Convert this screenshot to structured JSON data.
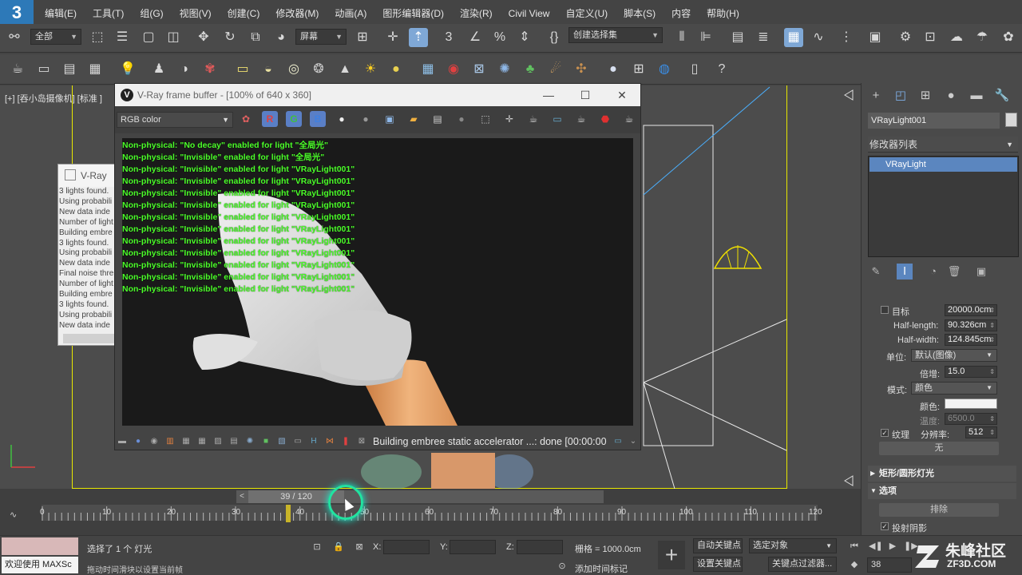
{
  "menu": {
    "logo": "3",
    "items": [
      "编辑(E)",
      "工具(T)",
      "组(G)",
      "视图(V)",
      "创建(C)",
      "修改器(M)",
      "动画(A)",
      "图形编辑器(D)",
      "渲染(R)",
      "Civil View",
      "自定义(U)",
      "脚本(S)",
      "内容",
      "帮助(H)"
    ]
  },
  "toolbar": {
    "filter_label": "全部",
    "ref_coord_label": "屏幕",
    "selection_set_label": "创建选择集"
  },
  "viewport": {
    "label": "[+] [吞小岛摄像机] [标准 ]"
  },
  "vray_log": {
    "title": "V-Ray",
    "lines": [
      "3 lights found.",
      "Using probabili",
      "New data inde",
      "Number of light",
      "Building embre",
      "3 lights found.",
      "Using probabili",
      "New data inde",
      "Final noise thre",
      "Number of light",
      "Building embre",
      "3 lights found.",
      "Using probabili",
      "New data inde"
    ]
  },
  "frame_buffer": {
    "title": "V-Ray frame buffer - [100% of 640 x 360]",
    "logo": "V",
    "channel": "RGB color",
    "minimize": "—",
    "maximize": "☐",
    "close": "✕",
    "render_log": [
      "Non-physical: \"No decay\" enabled for light \"全局光\"",
      "Non-physical: \"Invisible\" enabled for light \"全局光\"",
      "Non-physical: \"Invisible\" enabled for light \"VRayLight001\"",
      "Non-physical: \"Invisible\" enabled for light \"VRayLight001\"",
      "Non-physical: \"Invisible\" enabled for light \"VRayLight001\"",
      "Non-physical: \"Invisible\" enabled for light \"VRayLight001\"",
      "Non-physical: \"Invisible\" enabled for light \"VRayLight001\"",
      "Non-physical: \"Invisible\" enabled for light \"VRayLight001\"",
      "Non-physical: \"Invisible\" enabled for light \"VRayLight001\"",
      "Non-physical: \"Invisible\" enabled for light \"VRayLight001\"",
      "Non-physical: \"Invisible\" enabled for light \"VRayLight001\"",
      "Non-physical: \"Invisible\" enabled for light \"VRayLight001\"",
      "Non-physical: \"Invisible\" enabled for light \"VRayLight001\""
    ],
    "status": "Building embree static accelerator ...: done [00:00:00"
  },
  "command_panel": {
    "object_name": "VRayLight001",
    "modifier_list": "修改器列表",
    "stack_item": "VRayLight",
    "params": {
      "target_label": "目标",
      "target_value": "20000.0cm",
      "half_length_label": "Half-length:",
      "half_length_value": "90.326cm",
      "half_width_label": "Half-width:",
      "half_width_value": "124.845cm",
      "units_label": "单位:",
      "units_value": "默认(图像)",
      "multiplier_label": "倍增:",
      "multiplier_value": "15.0",
      "mode_label": "模式:",
      "mode_value": "颜色",
      "color_label": "颜色:",
      "temperature_label": "温度:",
      "temperature_value": "6500.0",
      "texture_label": "纹理",
      "resolution_label": "分辨率:",
      "resolution_value": "512",
      "none_button": "无"
    },
    "rollout_rect": "矩形/圆形灯光",
    "rollout_options": "选项",
    "exclude_button": "排除",
    "cast_shadows_label": "投射阴影"
  },
  "timeline": {
    "slider_text": "39 / 120",
    "ticks": [
      "0",
      "10",
      "20",
      "30",
      "40",
      "50",
      "60",
      "70",
      "80",
      "90",
      "100",
      "110",
      "120"
    ]
  },
  "status_bar": {
    "maxscript": "欢迎使用 MAXSc",
    "line1": "选择了 1 个 灯光",
    "line2": "拖动时间滑块以设置当前帧",
    "x_label": "X:",
    "y_label": "Y:",
    "z_label": "Z:",
    "grid": "栅格 = 1000.0cm",
    "add_time_tag": "添加时间标记",
    "auto_key": "自动关键点",
    "set_key": "设置关键点",
    "selected_object": "选定对象",
    "key_filters": "关键点过滤器...",
    "frame_value": "38"
  },
  "watermark": {
    "text": "朱峰社区",
    "url": "ZF3D.COM"
  }
}
